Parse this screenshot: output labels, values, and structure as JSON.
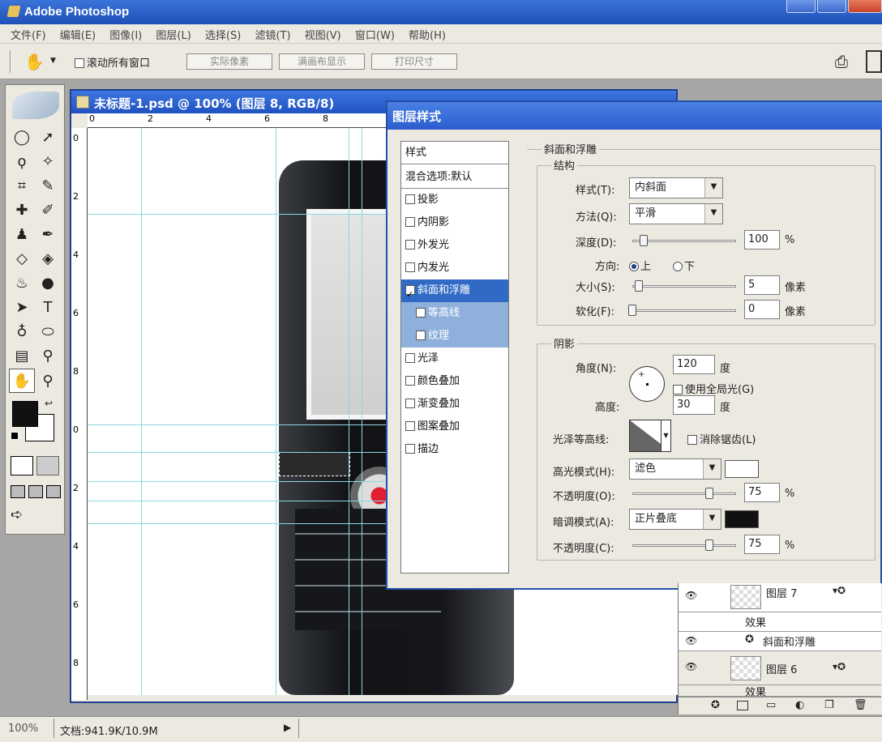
{
  "app": {
    "title": "Adobe Photoshop"
  },
  "menu": [
    "文件(F)",
    "编辑(E)",
    "图像(I)",
    "图层(L)",
    "选择(S)",
    "滤镜(T)",
    "视图(V)",
    "窗口(W)",
    "帮助(H)"
  ],
  "options": {
    "hand_icon": "hand-icon",
    "scroll_all_label": "滚动所有窗口",
    "scroll_all_checked": false,
    "actual_pixels": "实际像素",
    "fit_screen": "满画布显示",
    "print_size": "打印尺寸"
  },
  "document": {
    "title": "未标题-1.psd @ 100% (图层 8, RGB/8)",
    "ruler_h": [
      "0",
      "2",
      "4",
      "6",
      "8"
    ],
    "ruler_v": [
      "0",
      "2",
      "4",
      "6",
      "8",
      "0",
      "2",
      "4",
      "6",
      "8"
    ]
  },
  "dialog": {
    "title": "图层样式",
    "styles": [
      {
        "label": "样式",
        "kind": "header"
      },
      {
        "label": "混合选项:默认",
        "kind": "header"
      },
      {
        "label": "投影",
        "checked": false
      },
      {
        "label": "内阴影",
        "checked": false
      },
      {
        "label": "外发光",
        "checked": false
      },
      {
        "label": "内发光",
        "checked": false
      },
      {
        "label": "斜面和浮雕",
        "checked": true,
        "selected": true
      },
      {
        "label": "等高线",
        "checked": false,
        "sub": true
      },
      {
        "label": "纹理",
        "checked": false,
        "sub": true
      },
      {
        "label": "光泽",
        "checked": false
      },
      {
        "label": "颜色叠加",
        "checked": false
      },
      {
        "label": "渐变叠加",
        "checked": false
      },
      {
        "label": "图案叠加",
        "checked": false
      },
      {
        "label": "描边",
        "checked": false
      }
    ],
    "bevel": {
      "section": "斜面和浮雕",
      "structure": "结构",
      "style_label": "样式(T):",
      "style_value": "内斜面",
      "technique_label": "方法(Q):",
      "technique_value": "平滑",
      "depth_label": "深度(D):",
      "depth_value": "100",
      "depth_unit": "%",
      "direction_label": "方向:",
      "dir_up": "上",
      "dir_down": "下",
      "direction": "up",
      "size_label": "大小(S):",
      "size_value": "5",
      "size_unit": "像素",
      "soften_label": "软化(F):",
      "soften_value": "0",
      "soften_unit": "像素"
    },
    "shading": {
      "section": "阴影",
      "angle_label": "角度(N):",
      "angle_value": "120",
      "angle_unit": "度",
      "global_light_label": "使用全局光(G)",
      "global_light_checked": false,
      "altitude_label": "高度:",
      "altitude_value": "30",
      "altitude_unit": "度",
      "gloss_contour_label": "光泽等高线:",
      "anti_alias_label": "消除锯齿(L)",
      "anti_alias_checked": false,
      "highlight_mode_label": "高光模式(H):",
      "highlight_mode_value": "滤色",
      "highlight_color": "#ffffff",
      "highlight_opacity_label": "不透明度(O):",
      "highlight_opacity_value": "75",
      "highlight_opacity_unit": "%",
      "shadow_mode_label": "暗调模式(A):",
      "shadow_mode_value": "正片叠底",
      "shadow_color": "#111111",
      "shadow_opacity_label": "不透明度(C):",
      "shadow_opacity_value": "75",
      "shadow_opacity_unit": "%"
    }
  },
  "layers": {
    "rows": [
      {
        "name": "图层 7",
        "type": "layer"
      },
      {
        "name": "效果",
        "type": "effects"
      },
      {
        "name": "斜面和浮雕",
        "type": "effect"
      },
      {
        "name": "图层 6",
        "type": "layer"
      },
      {
        "name": "效果",
        "type": "effects"
      }
    ]
  },
  "status": {
    "zoom": "100%",
    "doc": "文档:941.9K/10.9M"
  }
}
